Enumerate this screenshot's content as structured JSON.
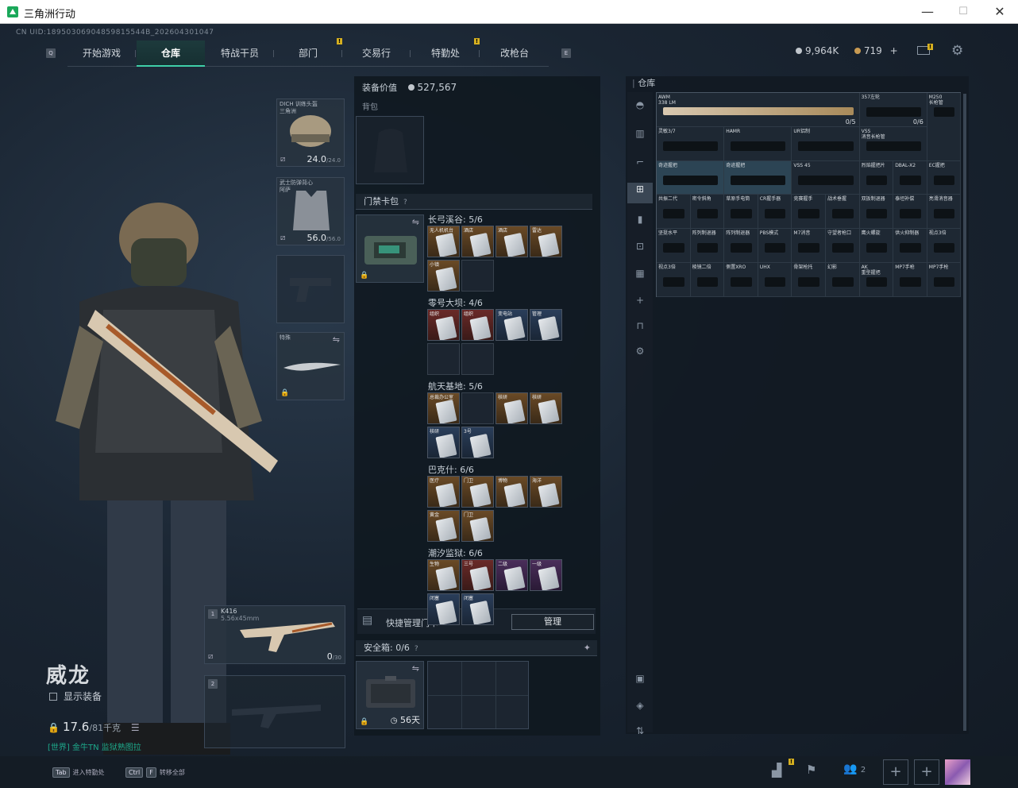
{
  "window": {
    "title": "三角洲行动",
    "minimize": "—",
    "maximize": "☐",
    "close": "✕"
  },
  "uid": "CN UID:18950306904859815544B_202604301047",
  "tabs": [
    "开始游戏",
    "仓库",
    "特战干员",
    "部门",
    "交易行",
    "特勤处",
    "改枪台"
  ],
  "active_tab": 1,
  "keys": {
    "left": "Q",
    "right": "E"
  },
  "currency": {
    "silver": "9,964K",
    "gold": "719",
    "gold_add": "+"
  },
  "character": {
    "name": "威龙",
    "show_equipment": "显示装备",
    "weight": "17.6",
    "weight_max": "/81千克",
    "tags": "[世界] 金牛TN  监狱熟图拉"
  },
  "gear": {
    "helmet": {
      "label": "DICH 训练头盔\n三角洲",
      "value": "24.0",
      "max": "/24.0"
    },
    "armor": {
      "label": "武士防弹背心\n阿萨",
      "value": "56.0",
      "max": "/56.0"
    },
    "melee_label": "特殊"
  },
  "weapons": {
    "primary": {
      "slot": "1",
      "name": "K416",
      "ammo": "5.56x45mm",
      "count": "0",
      "count_max": "/30"
    },
    "secondary": {
      "slot": "2"
    }
  },
  "equip_value": {
    "label": "装备价值",
    "value": "527,567"
  },
  "backpack_label": "背包",
  "keycard_bag": {
    "title": "门禁卡包",
    "groups": [
      {
        "name": "长弓溪谷: 5/6",
        "cards": [
          {
            "t": "无人机机台",
            "c": "gold"
          },
          {
            "t": "酒店",
            "c": "gold"
          },
          {
            "t": "酒店",
            "c": "gold"
          },
          {
            "t": "雷达",
            "c": "gold"
          },
          {
            "t": "小镇",
            "c": "gold"
          }
        ]
      },
      {
        "name": "零号大坝: 4/6",
        "cards": [
          {
            "t": "组织",
            "c": "red"
          },
          {
            "t": "组织",
            "c": "red"
          },
          {
            "t": "变电站",
            "c": "blue"
          },
          {
            "t": "管理",
            "c": "blue"
          }
        ]
      },
      {
        "name": "航天基地: 5/6",
        "cards": [
          {
            "t": "总裁办公室",
            "c": "gold"
          },
          {
            "t": "",
            "c": "empty"
          },
          {
            "t": "核研",
            "c": "gold"
          },
          {
            "t": "核研",
            "c": "gold"
          },
          {
            "t": "核研",
            "c": "blue"
          },
          {
            "t": "3号",
            "c": "blue"
          }
        ]
      },
      {
        "name": "巴克什: 6/6",
        "cards": [
          {
            "t": "医疗",
            "c": "gold"
          },
          {
            "t": "门卫",
            "c": "gold"
          },
          {
            "t": "博物",
            "c": "gold"
          },
          {
            "t": "海洋",
            "c": "gold"
          },
          {
            "t": "黄金",
            "c": "gold"
          },
          {
            "t": "门卫",
            "c": "gold"
          }
        ]
      },
      {
        "name": "潮汐监狱: 6/6",
        "cards": [
          {
            "t": "生物",
            "c": "gold"
          },
          {
            "t": "三号",
            "c": "red"
          },
          {
            "t": "二级",
            "c": "purple"
          },
          {
            "t": "一级",
            "c": "purple"
          },
          {
            "t": "闭塞",
            "c": "blue"
          },
          {
            "t": "闭塞",
            "c": "blue"
          }
        ]
      }
    ],
    "quick_manage": "快捷管理门卡",
    "manage_btn": "管理"
  },
  "safebox": {
    "title": "安全箱: 0/6",
    "days": "56天"
  },
  "warehouse": {
    "title": "仓库",
    "items": [
      {
        "t": "AWM\n338 LM",
        "r": 0,
        "c": 0,
        "w": 6,
        "cnt": "0/5"
      },
      {
        "t": "357左轮",
        "r": 0,
        "c": 6,
        "w": 2,
        "cnt": "0/6"
      },
      {
        "t": "M250\n长枪管",
        "r": 0,
        "c": 8,
        "w": 1,
        "h": 2
      },
      {
        "t": "灵敏3/7",
        "r": 1,
        "c": 0,
        "w": 2
      },
      {
        "t": "HAMR",
        "r": 1,
        "c": 2,
        "w": 2
      },
      {
        "t": "UR铝制",
        "r": 1,
        "c": 4,
        "w": 2
      },
      {
        "t": "VSS\n消音长枪管",
        "r": 1,
        "c": 6,
        "w": 2
      },
      {
        "t": "奇迹握把",
        "r": 2,
        "c": 0,
        "w": 2,
        "sel": true
      },
      {
        "t": "奇迹握把",
        "r": 2,
        "c": 2,
        "w": 2,
        "sel": true
      },
      {
        "t": "VSS 45",
        "r": 2,
        "c": 4,
        "w": 2
      },
      {
        "t": "烈焰握把片",
        "r": 2,
        "c": 6
      },
      {
        "t": "DBAL-X2",
        "r": 2,
        "c": 7
      },
      {
        "t": "EC握把",
        "r": 2,
        "c": 8
      },
      {
        "t": "共振二代",
        "r": 3,
        "c": 0
      },
      {
        "t": "密令斜角",
        "r": 3,
        "c": 1
      },
      {
        "t": "草原手电筒",
        "r": 3,
        "c": 2
      },
      {
        "t": "CR握手器",
        "r": 3,
        "c": 3
      },
      {
        "t": "竞赛握手",
        "r": 3,
        "c": 4
      },
      {
        "t": "战术垂握",
        "r": 3,
        "c": 5
      },
      {
        "t": "双扳制退器",
        "r": 3,
        "c": 6
      },
      {
        "t": "泰坦补偿",
        "r": 3,
        "c": 7
      },
      {
        "t": "亮滑消音器",
        "r": 3,
        "c": 8
      },
      {
        "t": "坚挺水平",
        "r": 4,
        "c": 0
      },
      {
        "t": "阵列制退器",
        "r": 4,
        "c": 1
      },
      {
        "t": "阵列制退器",
        "r": 4,
        "c": 2
      },
      {
        "t": "PBS模式",
        "r": 4,
        "c": 3
      },
      {
        "t": "M7消音",
        "r": 4,
        "c": 4
      },
      {
        "t": "守望者枪口",
        "r": 4,
        "c": 5
      },
      {
        "t": "鹰火螺旋",
        "r": 4,
        "c": 6
      },
      {
        "t": "供火抑制器",
        "r": 4,
        "c": 7
      },
      {
        "t": "视点3倍",
        "r": 4,
        "c": 8
      },
      {
        "t": "视点3倍",
        "r": 5,
        "c": 0
      },
      {
        "t": "棱镜二倍",
        "r": 5,
        "c": 1
      },
      {
        "t": "侧置XRO",
        "r": 5,
        "c": 2
      },
      {
        "t": "UHX",
        "r": 5,
        "c": 3
      },
      {
        "t": "骨架枪托",
        "r": 5,
        "c": 4
      },
      {
        "t": "幻影",
        "r": 5,
        "c": 5
      },
      {
        "t": "AK\n重型握把",
        "r": 5,
        "c": 6
      },
      {
        "t": "MP7手枪",
        "r": 5,
        "c": 7
      },
      {
        "t": "MP7手枪",
        "r": 5,
        "c": 8
      }
    ]
  },
  "bottom": {
    "tab_key": "Tab",
    "tab_text": "进入特勤处",
    "ctrl_key": "Ctrl",
    "f_key": "F",
    "f_text": "转移全部",
    "team_count": "2"
  },
  "colors": {
    "accent": "#3fcfa8",
    "badge": "#d6b020"
  }
}
